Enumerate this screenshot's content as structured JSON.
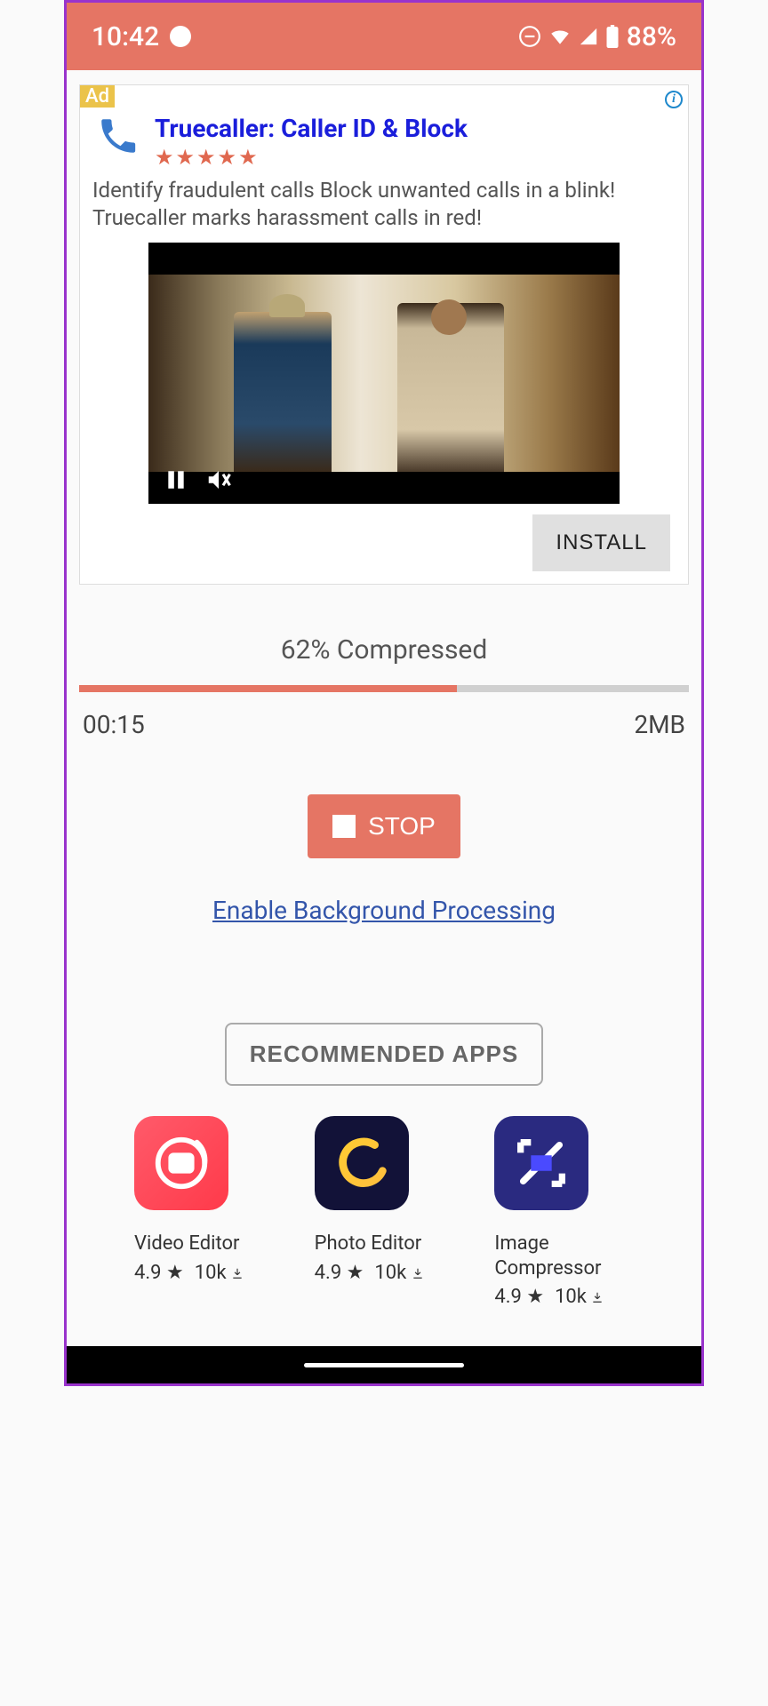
{
  "status": {
    "time": "10:42",
    "battery": "88%"
  },
  "ad": {
    "badge": "Ad",
    "title": "Truecaller: Caller ID & Block",
    "desc": "Identify fraudulent calls Block unwanted calls in a blink! Truecaller marks harassment calls in red!",
    "install": "INSTALL"
  },
  "progress": {
    "label": "62% Compressed",
    "percent": 62,
    "elapsed": "00:15",
    "size": "2MB"
  },
  "actions": {
    "stop": "STOP",
    "bg_link": "Enable Background Processing",
    "recommended": "RECOMMENDED APPS"
  },
  "apps": [
    {
      "name": "Video Editor",
      "rating": "4.9",
      "downloads": "10k"
    },
    {
      "name": "Photo Editor",
      "rating": "4.9",
      "downloads": "10k"
    },
    {
      "name": "Image Compressor",
      "rating": "4.9",
      "downloads": "10k"
    }
  ]
}
